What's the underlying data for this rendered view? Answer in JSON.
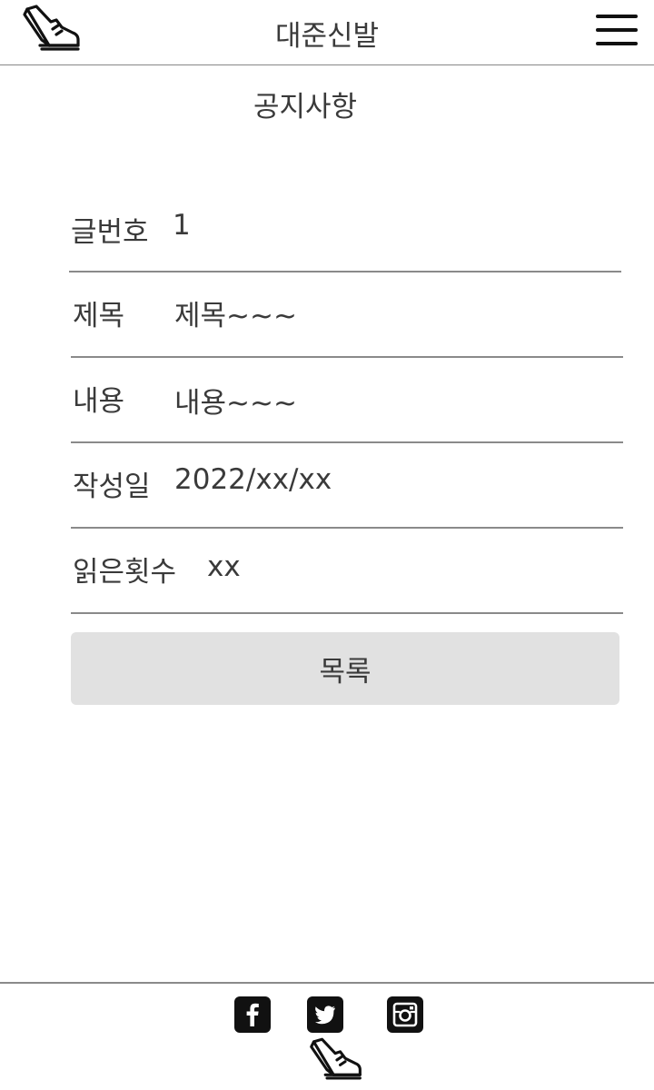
{
  "header": {
    "title": "대준신발",
    "logo_icon": "sneaker-icon",
    "menu_icon": "hamburger-menu-icon"
  },
  "page": {
    "heading": "공지사항"
  },
  "notice": {
    "fields": [
      {
        "label": "글번호",
        "value": "1"
      },
      {
        "label": "제목",
        "value": "제목~~~"
      },
      {
        "label": "내용",
        "value": "내용~~~"
      },
      {
        "label": "작성일",
        "value": "2022/xx/xx"
      },
      {
        "label": "읽은횟수",
        "value": "xx"
      }
    ]
  },
  "actions": {
    "list_label": "목록"
  },
  "footer": {
    "social_icons": [
      "facebook-icon",
      "twitter-icon",
      "instagram-icon"
    ],
    "logo_icon": "sneaker-icon"
  },
  "colors": {
    "text": "#3a3a3a",
    "divider": "#8a8a8a",
    "button_bg": "#e1e1e1",
    "icon": "#111111"
  }
}
